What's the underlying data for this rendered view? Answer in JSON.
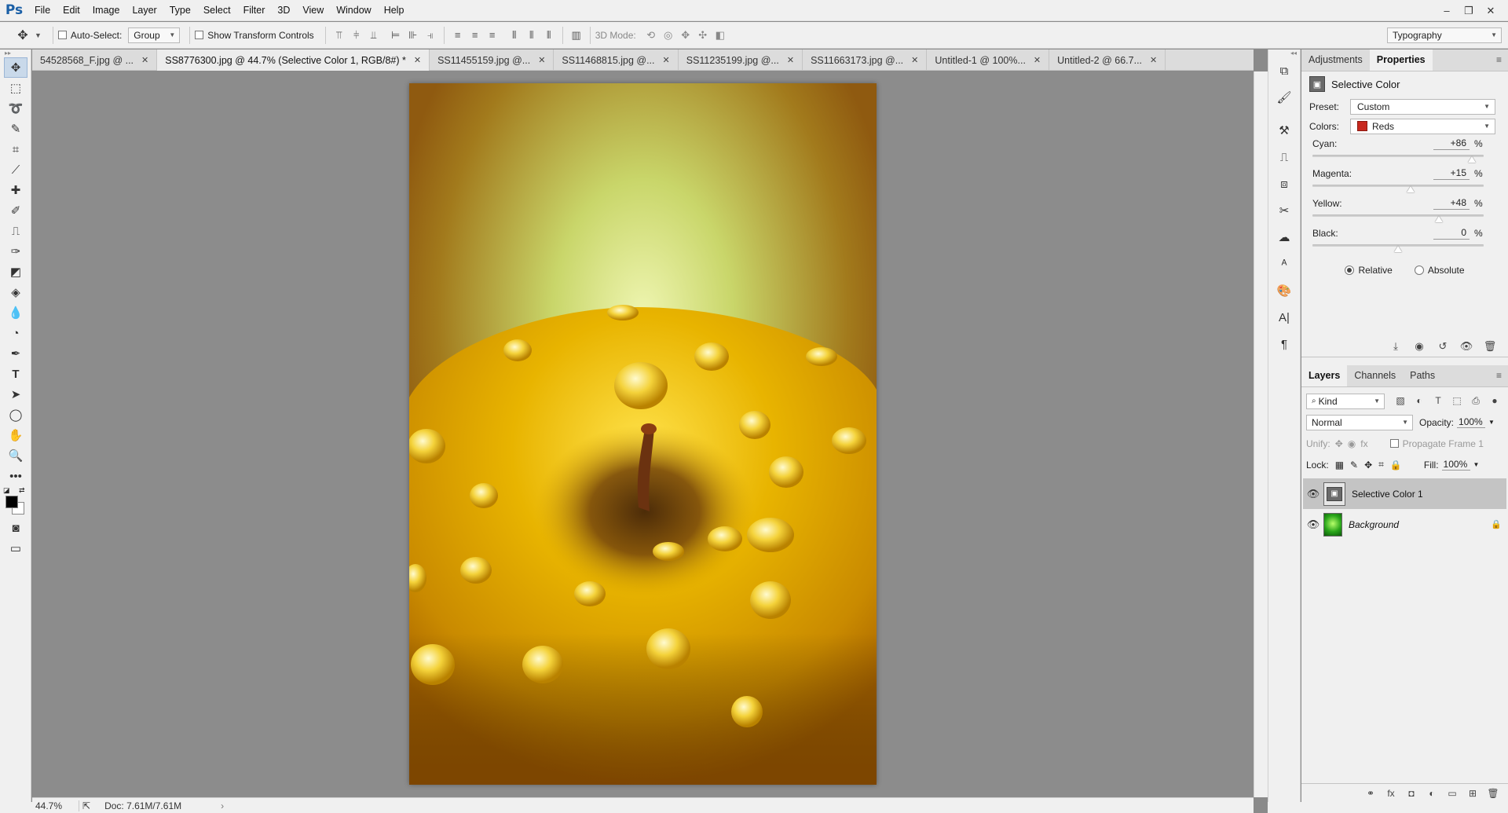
{
  "app": {
    "logo": "Ps",
    "menu": [
      "File",
      "Edit",
      "Image",
      "Layer",
      "Type",
      "Select",
      "Filter",
      "3D",
      "View",
      "Window",
      "Help"
    ],
    "window_controls": [
      "–",
      "❐",
      "✕"
    ]
  },
  "options_bar": {
    "auto_select_label": "Auto-Select:",
    "auto_select_value": "Group",
    "show_transform_label": "Show Transform Controls",
    "mode_3d_label": "3D Mode:",
    "workspace": "Typography"
  },
  "tabs": [
    {
      "label": "54528568_F.jpg @ ...",
      "active": false
    },
    {
      "label": "SS8776300.jpg @ 44.7% (Selective Color 1, RGB/8#) *",
      "active": true
    },
    {
      "label": "SS11455159.jpg @...",
      "active": false
    },
    {
      "label": "SS11468815.jpg @...",
      "active": false
    },
    {
      "label": "SS11235199.jpg @...",
      "active": false
    },
    {
      "label": "SS11663173.jpg @...",
      "active": false
    },
    {
      "label": "Untitled-1 @ 100%...",
      "active": false
    },
    {
      "label": "Untitled-2 @ 66.7...",
      "active": false
    }
  ],
  "status": {
    "zoom": "44.7%",
    "doc": "Doc: 7.61M/7.61M",
    "more": "›"
  },
  "properties_panel": {
    "tabs": [
      "Adjustments",
      "Properties"
    ],
    "active_tab": "Properties",
    "title": "Selective Color",
    "preset_label": "Preset:",
    "preset_value": "Custom",
    "colors_label": "Colors:",
    "colors_value": "Reds",
    "colors_chip": "#c8281e",
    "sliders": [
      {
        "label": "Cyan:",
        "value": "+86",
        "unit": "%",
        "num": 86
      },
      {
        "label": "Magenta:",
        "value": "+15",
        "unit": "%",
        "num": 15
      },
      {
        "label": "Yellow:",
        "value": "+48",
        "unit": "%",
        "num": 48
      },
      {
        "label": "Black:",
        "value": "0",
        "unit": "%",
        "num": 0
      }
    ],
    "method": {
      "relative": "Relative",
      "absolute": "Absolute",
      "selected": "Relative"
    }
  },
  "layers_panel": {
    "tabs": [
      "Layers",
      "Channels",
      "Paths"
    ],
    "active_tab": "Layers",
    "kind": "Kind",
    "blend_mode": "Normal",
    "opacity_label": "Opacity:",
    "opacity_value": "100%",
    "unify_label": "Unify:",
    "propagate_label": "Propagate Frame 1",
    "lock_label": "Lock:",
    "fill_label": "Fill:",
    "fill_value": "100%",
    "layers": [
      {
        "name": "Selective Color 1",
        "selected": true,
        "type": "adjustment"
      },
      {
        "name": "Background",
        "selected": false,
        "type": "image",
        "locked": true
      }
    ]
  }
}
